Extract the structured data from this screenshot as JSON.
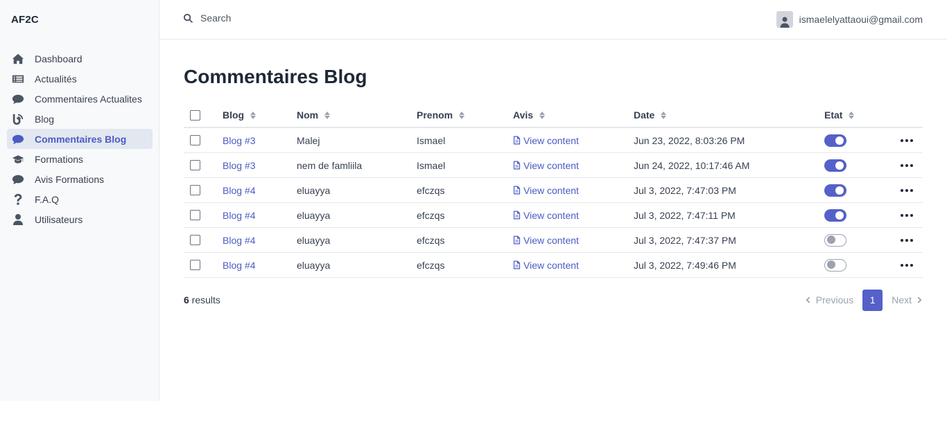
{
  "brand": "AF2C",
  "sidebar": {
    "items": [
      {
        "label": "Dashboard",
        "icon": "home-icon"
      },
      {
        "label": "Actualités",
        "icon": "newspaper-icon"
      },
      {
        "label": "Commentaires Actualites",
        "icon": "comment-icon"
      },
      {
        "label": "Blog",
        "icon": "blog-icon"
      },
      {
        "label": "Commentaires Blog",
        "icon": "comment-icon",
        "active": true
      },
      {
        "label": "Formations",
        "icon": "graduation-cap-icon"
      },
      {
        "label": "Avis Formations",
        "icon": "comment-icon"
      },
      {
        "label": "F.A.Q",
        "icon": "question-icon"
      },
      {
        "label": "Utilisateurs",
        "icon": "user-icon"
      }
    ]
  },
  "topbar": {
    "search_placeholder": "Search",
    "user_email": "ismaelelyattaoui@gmail.com"
  },
  "main": {
    "title": "Commentaires Blog",
    "table": {
      "columns": [
        "Blog",
        "Nom",
        "Prenom",
        "Avis",
        "Date",
        "Etat"
      ],
      "rows": [
        {
          "blog": "Blog #3",
          "nom": "Malej",
          "prenom": "Ismael",
          "avis": "View content",
          "date": "Jun 23, 2022, 8:03:26 PM",
          "etat": true
        },
        {
          "blog": "Blog #3",
          "nom": "nem de famliila",
          "prenom": "Ismael",
          "avis": "View content",
          "date": "Jun 24, 2022, 10:17:46 AM",
          "etat": true
        },
        {
          "blog": "Blog #4",
          "nom": "eluayya",
          "prenom": "efczqs",
          "avis": "View content",
          "date": "Jul 3, 2022, 7:47:03 PM",
          "etat": true
        },
        {
          "blog": "Blog #4",
          "nom": "eluayya",
          "prenom": "efczqs",
          "avis": "View content",
          "date": "Jul 3, 2022, 7:47:11 PM",
          "etat": true
        },
        {
          "blog": "Blog #4",
          "nom": "eluayya",
          "prenom": "efczqs",
          "avis": "View content",
          "date": "Jul 3, 2022, 7:47:37 PM",
          "etat": false
        },
        {
          "blog": "Blog #4",
          "nom": "eluayya",
          "prenom": "efczqs",
          "avis": "View content",
          "date": "Jul 3, 2022, 7:49:46 PM",
          "etat": false
        }
      ]
    },
    "footer": {
      "results_count": "6",
      "results_label": " results",
      "previous": "Previous",
      "current_page": "1",
      "next": "Next"
    }
  },
  "colors": {
    "accent": "#5561c8",
    "link": "#4a5bc4",
    "active_bg": "#e2e7f0"
  }
}
